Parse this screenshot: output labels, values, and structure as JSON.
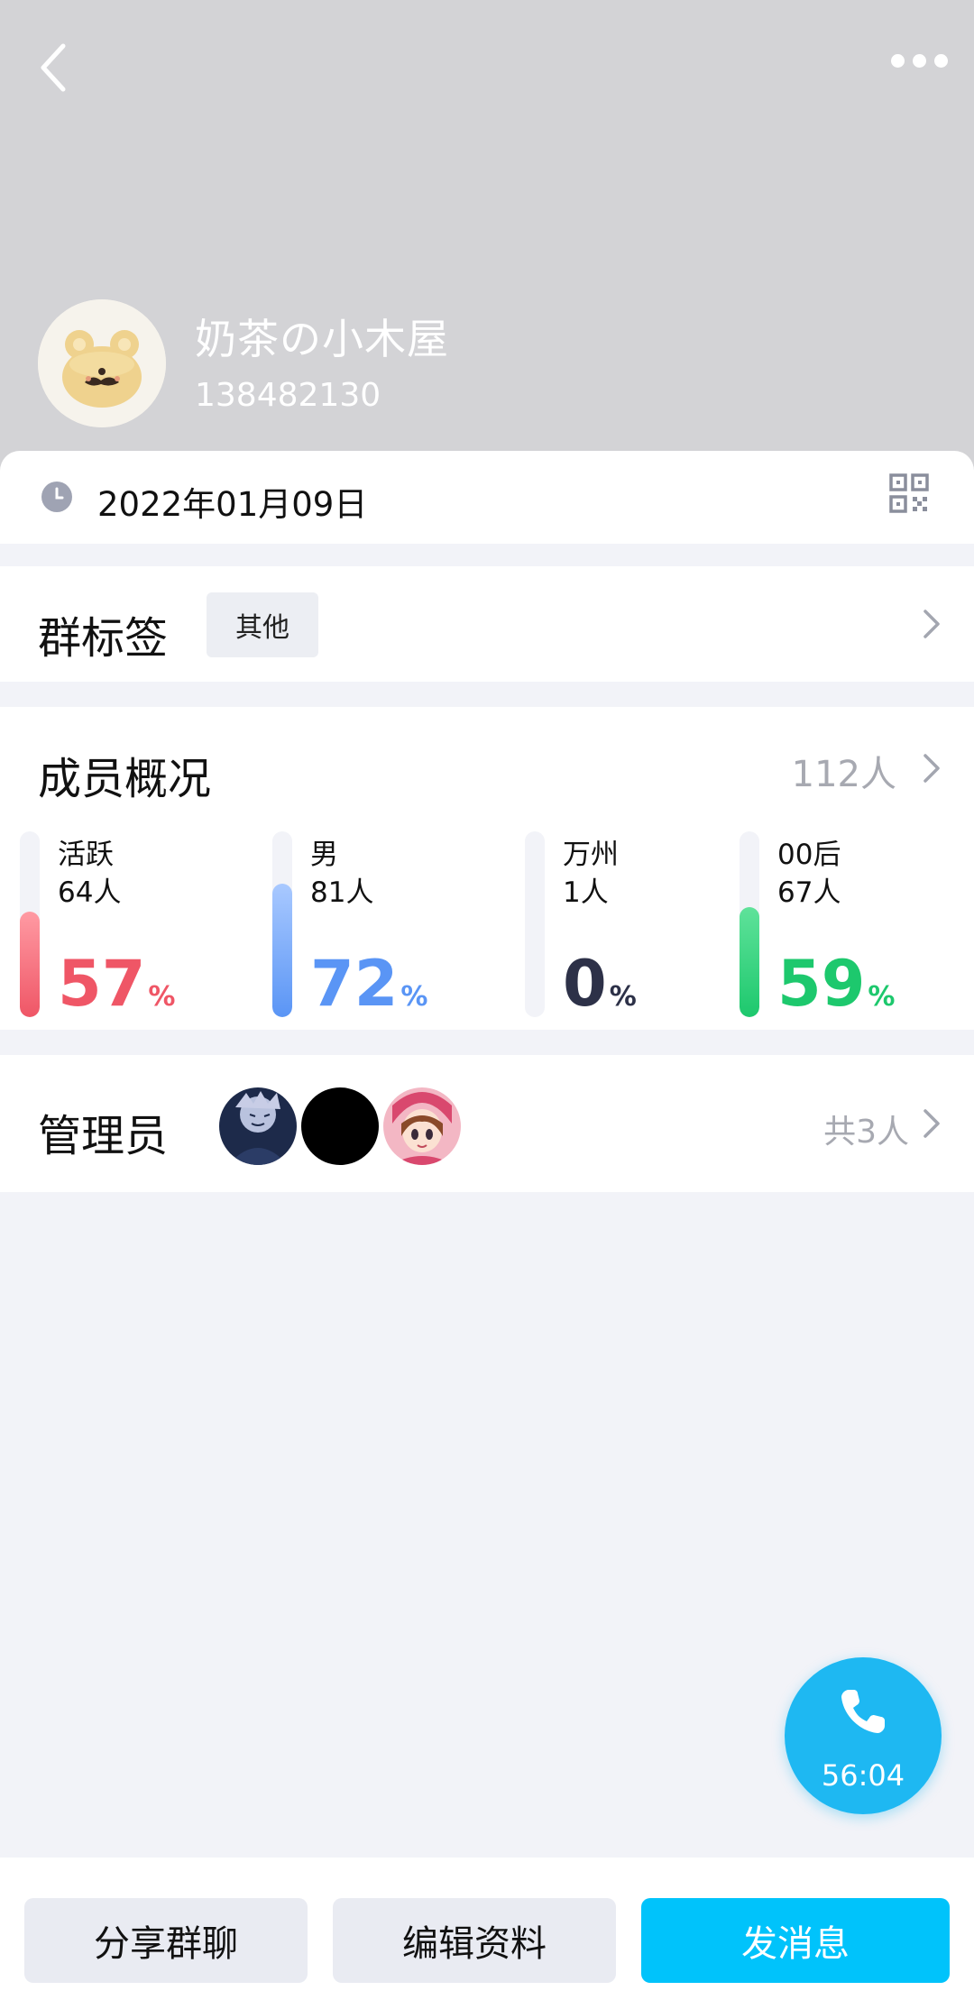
{
  "header": {
    "group_name": "奶茶の小木屋",
    "group_id": "138482130"
  },
  "info": {
    "created_date": "2022年01月09日"
  },
  "tags": {
    "title": "群标签",
    "tag": "其他"
  },
  "members": {
    "title": "成员概况",
    "count_label": "112人",
    "stats": [
      {
        "label": "活跃",
        "count": "64人",
        "percent": "57",
        "percent_value": 57,
        "color": "#ef5666",
        "color_light": "#ff9aa3"
      },
      {
        "label": "男",
        "count": "81人",
        "percent": "72",
        "percent_value": 72,
        "color": "#5a95f5",
        "color_light": "#a9c9ff"
      },
      {
        "label": "万州",
        "count": "1人",
        "percent": "0",
        "percent_value": 0,
        "color": "#2d3148",
        "color_light": "#2d3148"
      },
      {
        "label": "00后",
        "count": "67人",
        "percent": "59",
        "percent_value": 59,
        "color": "#1dc86d",
        "color_light": "#5fe29a"
      }
    ],
    "percent_sign": "%"
  },
  "admins": {
    "title": "管理员",
    "count_label": "共3人",
    "avatars": [
      "anime-boy-avatar",
      "black-avatar",
      "anime-girl-avatar"
    ]
  },
  "call": {
    "timer": "56:04"
  },
  "actions": {
    "share": "分享群聊",
    "edit": "编辑资料",
    "send": "发消息"
  },
  "colors": {
    "header_bg": "#d3d3d6",
    "accent": "#00c3fb",
    "fab": "#1eb8f2"
  }
}
